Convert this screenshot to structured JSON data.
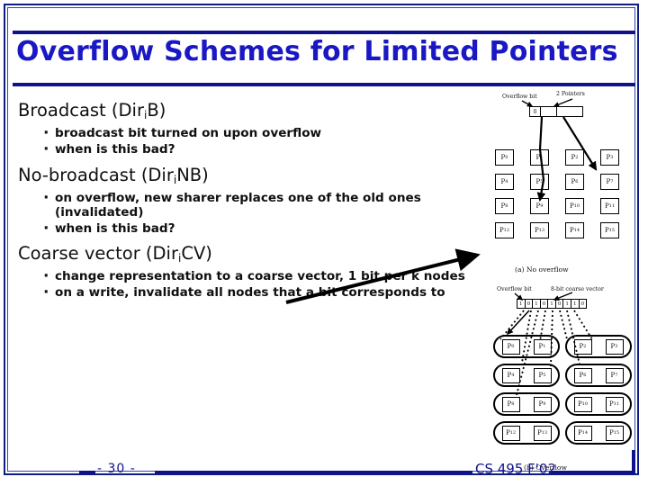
{
  "slide": {
    "title": "Overflow Schemes for Limited Pointers",
    "accent_color": "#1a18c4",
    "rule_color": "#10128c"
  },
  "sections": [
    {
      "heading_main": "Broadcast (Dir",
      "heading_sub": "i",
      "heading_tail": "B)",
      "bullets": [
        "broadcast bit turned on upon overflow",
        "when is this bad?"
      ]
    },
    {
      "heading_main": "No-broadcast (Dir",
      "heading_sub": "i",
      "heading_tail": "NB)",
      "bullets": [
        "on overflow, new sharer replaces one of the old ones (invalidated)",
        "when is this bad?"
      ]
    },
    {
      "heading_main": "Coarse vector (Dir",
      "heading_sub": "i",
      "heading_tail": "CV)",
      "bullets": [
        "change representation to a coarse vector, 1 bit per k nodes",
        "on a write, invalidate all nodes that a bit corresponds to"
      ]
    }
  ],
  "figure_a": {
    "label_overflow": "Overflow bit",
    "label_pointers": "2 Pointers",
    "caption": "(a) No overflow",
    "record_cells": [
      "0",
      "",
      ""
    ],
    "nodes": [
      [
        "P0",
        "P1",
        "P2",
        "P3"
      ],
      [
        "P4",
        "P5",
        "P6",
        "P7"
      ],
      [
        "P8",
        "P9",
        "P10",
        "P11"
      ],
      [
        "P12",
        "P13",
        "P14",
        "P15"
      ]
    ],
    "node_labels": [
      [
        {
          "p": "P",
          "s": "0"
        },
        {
          "p": "P",
          "s": "1"
        },
        {
          "p": "P",
          "s": "2"
        },
        {
          "p": "P",
          "s": "3"
        }
      ],
      [
        {
          "p": "P",
          "s": "4"
        },
        {
          "p": "P",
          "s": "5"
        },
        {
          "p": "P",
          "s": "6"
        },
        {
          "p": "P",
          "s": "7"
        }
      ],
      [
        {
          "p": "P",
          "s": "8"
        },
        {
          "p": "P",
          "s": "9"
        },
        {
          "p": "P",
          "s": "10"
        },
        {
          "p": "P",
          "s": "11"
        }
      ],
      [
        {
          "p": "P",
          "s": "12"
        },
        {
          "p": "P",
          "s": "13"
        },
        {
          "p": "P",
          "s": "14"
        },
        {
          "p": "P",
          "s": "15"
        }
      ]
    ],
    "pointer_targets": [
      "P9",
      "P7"
    ]
  },
  "figure_b": {
    "label_overflow": "Overflow bit",
    "label_vector": "8-bit coarse vector",
    "caption": "(b) Overflow",
    "vector_bits": [
      "1",
      "0",
      "1",
      "0",
      "1",
      "0",
      "1",
      "1",
      "0"
    ],
    "node_labels": [
      [
        {
          "p": "P",
          "s": "0"
        },
        {
          "p": "P",
          "s": "1"
        },
        {
          "p": "P",
          "s": "2"
        },
        {
          "p": "P",
          "s": "3"
        }
      ],
      [
        {
          "p": "P",
          "s": "4"
        },
        {
          "p": "P",
          "s": "5"
        },
        {
          "p": "P",
          "s": "6"
        },
        {
          "p": "P",
          "s": "7"
        }
      ],
      [
        {
          "p": "P",
          "s": "8"
        },
        {
          "p": "P",
          "s": "9"
        },
        {
          "p": "P",
          "s": "10"
        },
        {
          "p": "P",
          "s": "11"
        }
      ],
      [
        {
          "p": "P",
          "s": "12"
        },
        {
          "p": "P",
          "s": "13"
        },
        {
          "p": "P",
          "s": "14"
        },
        {
          "p": "P",
          "s": "15"
        }
      ]
    ]
  },
  "footer": {
    "page_number": "- 30 -",
    "course": "CS 495 F'02"
  }
}
